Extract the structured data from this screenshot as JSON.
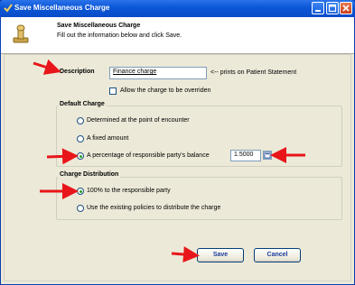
{
  "window": {
    "title": "Save Miscellaneous Charge",
    "header_title": "Save Miscellaneous Charge",
    "header_subtitle": "Fill out the information below and click Save."
  },
  "form": {
    "description_label": "Description",
    "description_value": "Finance charge",
    "description_note": "<-- prints on Patient Statement",
    "override_label": "Allow the charge to be overriden",
    "override_checked": false
  },
  "default_charge": {
    "group_label": "Default Charge",
    "options": [
      {
        "label": "Determined at the point of encounter",
        "selected": false
      },
      {
        "label": "A fixed amount",
        "selected": false
      },
      {
        "label": "A percentage of responsible party's balance",
        "selected": true
      }
    ],
    "percentage_value": "1.5000"
  },
  "charge_distribution": {
    "group_label": "Charge Distribution",
    "options": [
      {
        "label": "100% to the responsible party",
        "selected": true
      },
      {
        "label": "Use the existing policies to distribute the charge",
        "selected": false
      }
    ]
  },
  "buttons": {
    "save": "Save",
    "cancel": "Cancel"
  },
  "colors": {
    "titlebar": "#0b56d6",
    "annotation_arrow": "#e8161a",
    "button_text": "#1a3a9a"
  },
  "icons": {
    "app": "app-icon",
    "header": "stamp-icon",
    "minimize": "minimize-icon",
    "maximize": "maximize-icon",
    "close": "close-icon",
    "calculator": "calculator-icon"
  }
}
